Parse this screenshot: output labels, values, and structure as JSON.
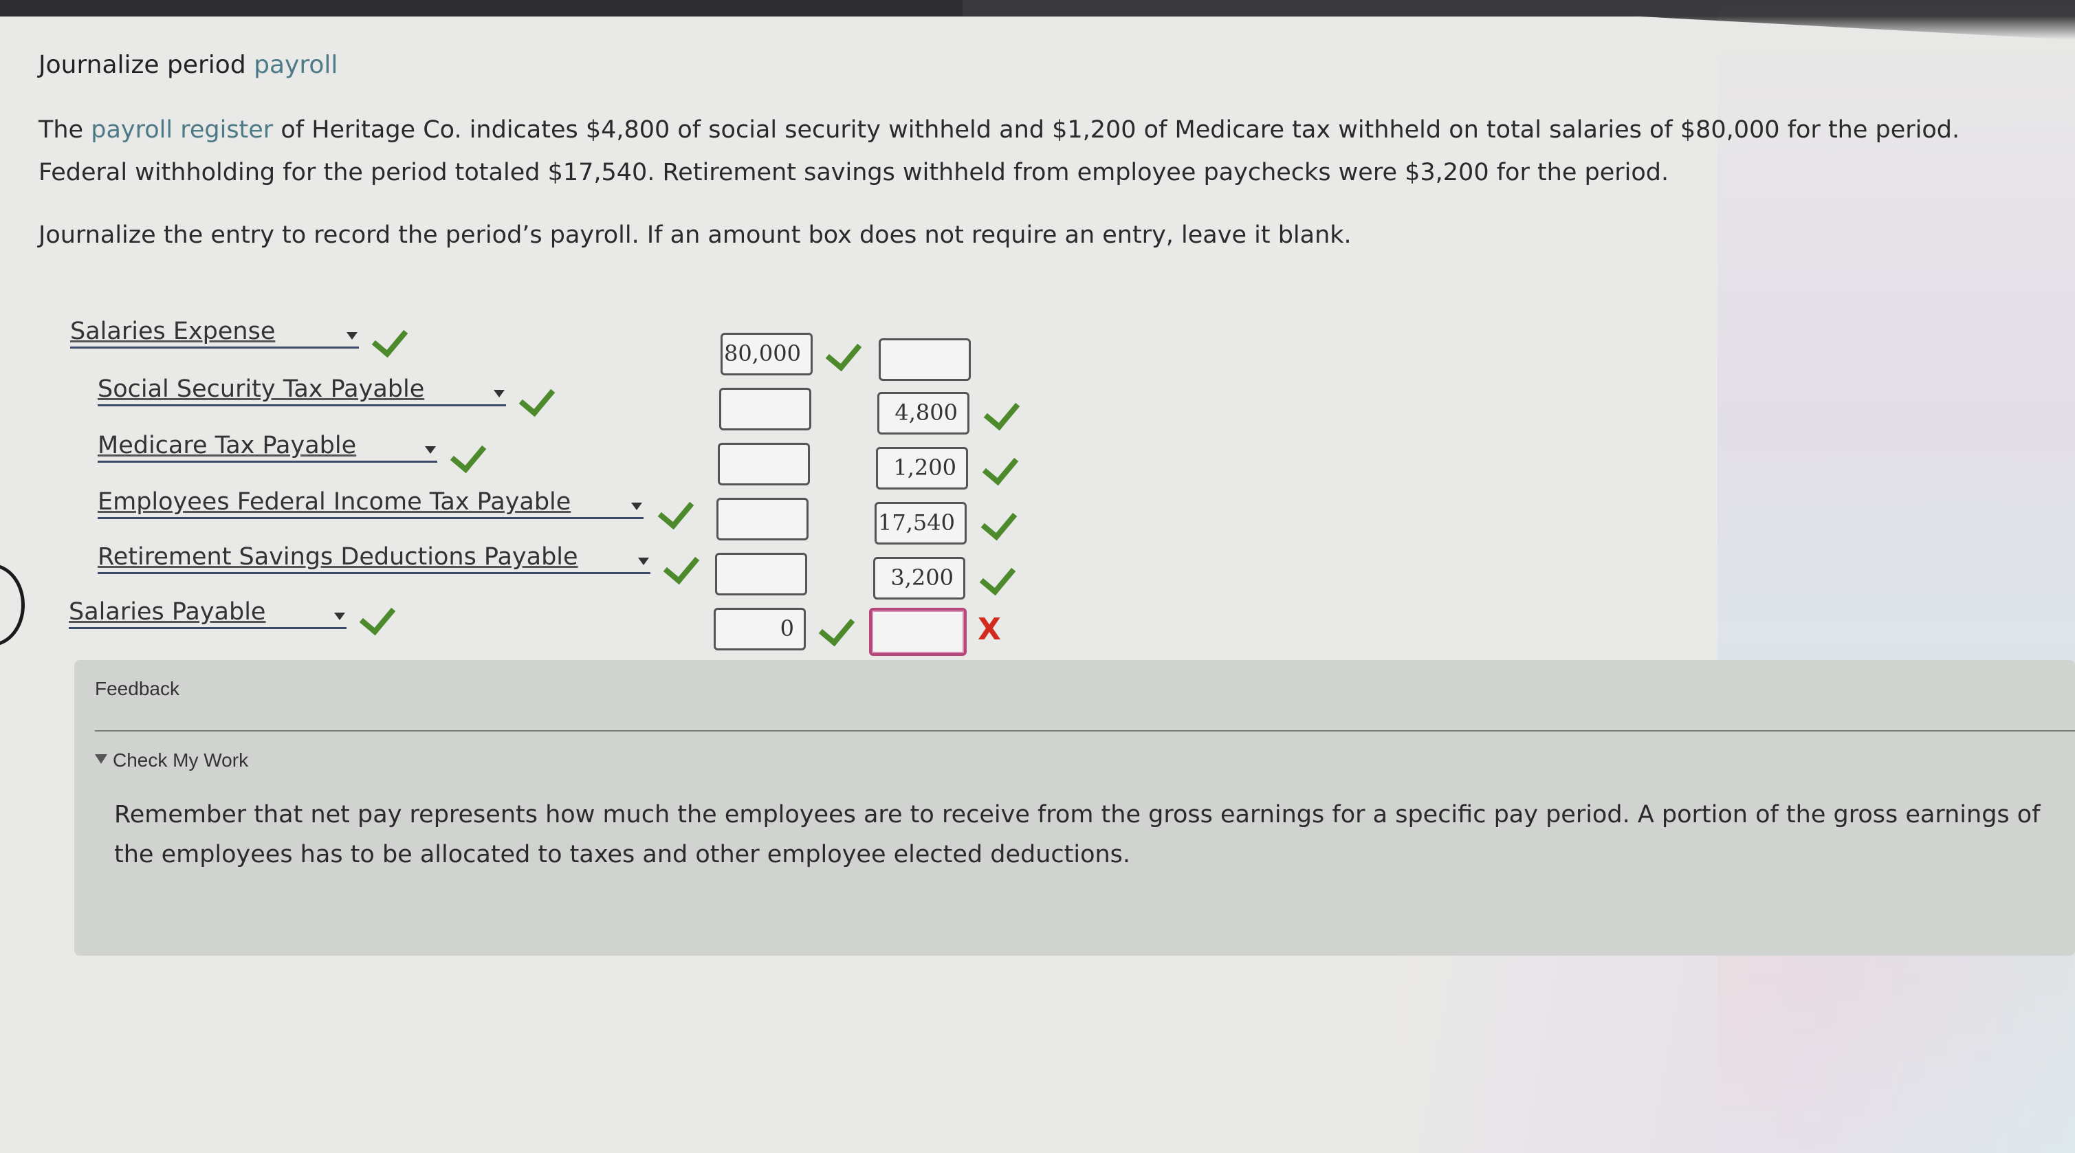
{
  "header": {
    "title_prefix": "Journalize period ",
    "title_term": "payroll"
  },
  "problem": {
    "para_prefix": "The ",
    "para_term": "payroll register",
    "para_rest": " of Heritage Co. indicates $4,800 of social security withheld and $1,200 of Medicare tax withheld on total salaries of $80,000 for the period. Federal withholding for the period totaled $17,540. Retirement savings withheld from employee paychecks were $3,200 for the period.",
    "instruction": "Journalize the entry to record the period’s payroll. If an amount box does not require an entry, leave it blank."
  },
  "journal": {
    "rows": [
      {
        "account": "Salaries Expense",
        "debit": "80,000",
        "credit": "",
        "debit_status": "correct",
        "credit_status": ""
      },
      {
        "account": "Social Security Tax Payable",
        "debit": "",
        "credit": "4,800",
        "debit_status": "",
        "credit_status": "correct"
      },
      {
        "account": "Medicare Tax Payable",
        "debit": "",
        "credit": "1,200",
        "debit_status": "",
        "credit_status": "correct"
      },
      {
        "account": "Employees Federal Income Tax Payable",
        "debit": "",
        "credit": "17,540",
        "debit_status": "",
        "credit_status": "correct"
      },
      {
        "account": "Retirement Savings Deductions Payable",
        "debit": "",
        "credit": "3,200",
        "debit_status": "",
        "credit_status": "correct"
      },
      {
        "account": "Salaries Payable",
        "debit": "0",
        "credit": "",
        "debit_status": "correct",
        "credit_status": "incorrect"
      }
    ],
    "incorrect_mark": "X"
  },
  "feedback": {
    "title": "Feedback",
    "check_my_work": "Check My Work",
    "message": "Remember that net pay represents how much the employees are to receive from the gross earnings for a specific pay period. A portion of the gross earnings of the employees has to be allocated to taxes and other employee elected deductions."
  },
  "colors": {
    "correct": "#4c8a2c",
    "incorrect": "#d12b1f",
    "term_link": "#4c7a86"
  },
  "icons": [
    "dropdown-caret-icon",
    "checkmark-icon",
    "x-mark-icon",
    "disclosure-triangle-icon"
  ]
}
